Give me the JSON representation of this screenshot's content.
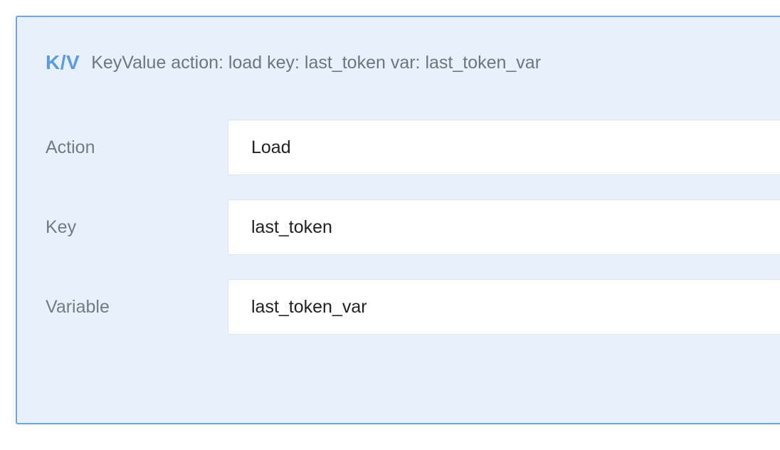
{
  "header": {
    "badge": "K/V",
    "summary": "KeyValue action: load key: last_token var: last_token_var"
  },
  "fields": {
    "action": {
      "label": "Action",
      "value": "Load"
    },
    "key": {
      "label": "Key",
      "value": "last_token"
    },
    "variable": {
      "label": "Variable",
      "value": "last_token_var"
    }
  },
  "colors": {
    "accent": "#5b9be0",
    "panel_background": "#e8f0fa",
    "panel_border": "#6fa3e3"
  }
}
